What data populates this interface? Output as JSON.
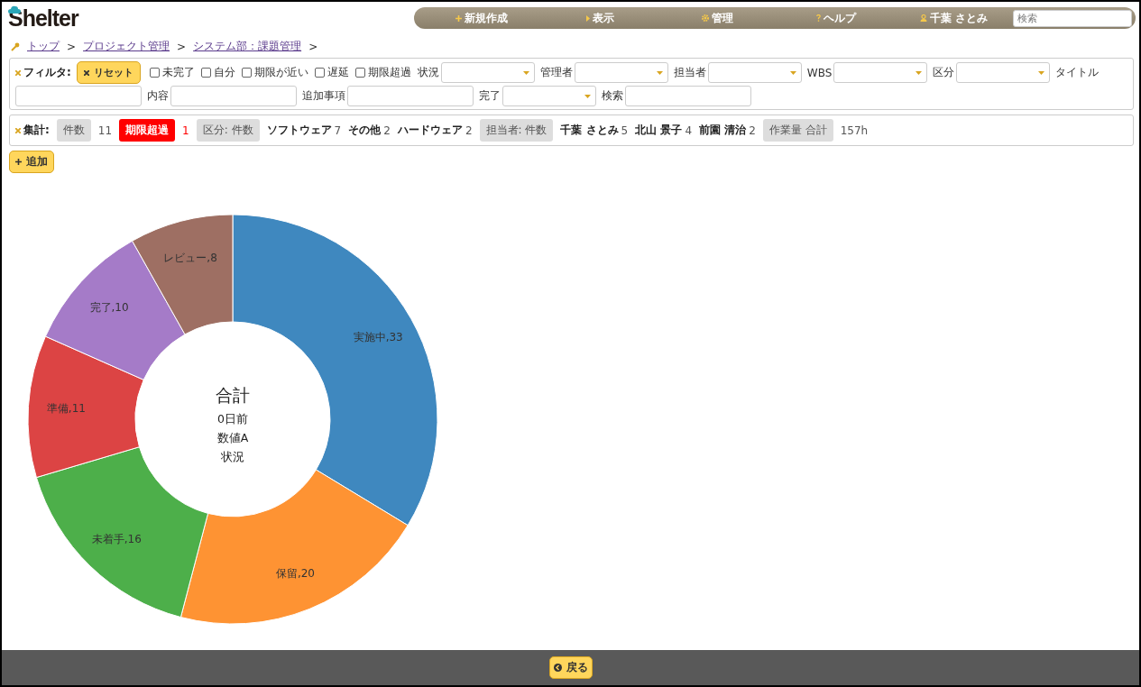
{
  "header": {
    "logo": "Shelter",
    "nav": [
      {
        "kind": "new",
        "label": "新規作成"
      },
      {
        "kind": "view",
        "label": "表示"
      },
      {
        "kind": "admin",
        "label": "管理"
      },
      {
        "kind": "help",
        "label": "ヘルプ"
      },
      {
        "kind": "user",
        "label": "千葉 さとみ"
      }
    ],
    "search": {
      "placeholder": "検索"
    }
  },
  "breadcrumb": [
    "トップ",
    "プロジェクト管理",
    "システム部：課題管理"
  ],
  "breadcrumb_separator": ">",
  "filter": {
    "label": "フィルタ:",
    "reset": "リセット",
    "checkboxes": [
      {
        "label": "未完了",
        "checked": false
      },
      {
        "label": "自分",
        "checked": false
      },
      {
        "label": "期限が近い",
        "checked": false
      },
      {
        "label": "遅延",
        "checked": false
      },
      {
        "label": "期限超過",
        "checked": false
      }
    ],
    "fields": [
      {
        "kind": "select",
        "label": "状況"
      },
      {
        "kind": "select",
        "label": "管理者"
      },
      {
        "kind": "select",
        "label": "担当者"
      },
      {
        "kind": "select",
        "label": "WBS"
      },
      {
        "kind": "select",
        "label": "区分"
      },
      {
        "kind": "text",
        "label": "タイトル"
      },
      {
        "kind": "text",
        "label": "内容"
      },
      {
        "kind": "text",
        "label": "追加事項"
      },
      {
        "kind": "select",
        "label": "完了"
      },
      {
        "kind": "text",
        "label": "検索"
      }
    ]
  },
  "summary": {
    "label": "集計:",
    "items": [
      {
        "kind": "chip",
        "text": "件数"
      },
      {
        "kind": "value",
        "text": "11"
      },
      {
        "kind": "alert",
        "text": "期限超過"
      },
      {
        "kind": "alert-value",
        "text": "1"
      },
      {
        "kind": "chip",
        "text": "区分: 件数"
      },
      {
        "kind": "name",
        "text": "ソフトウェア"
      },
      {
        "kind": "value",
        "text": "7"
      },
      {
        "kind": "name",
        "text": "その他"
      },
      {
        "kind": "value",
        "text": "2"
      },
      {
        "kind": "name",
        "text": "ハードウェア"
      },
      {
        "kind": "value",
        "text": "2"
      },
      {
        "kind": "chip",
        "text": "担当者: 件数"
      },
      {
        "kind": "name",
        "text": "千葉 さとみ"
      },
      {
        "kind": "value",
        "text": "5"
      },
      {
        "kind": "name",
        "text": "北山 景子"
      },
      {
        "kind": "value",
        "text": "4"
      },
      {
        "kind": "name",
        "text": "前園 清治"
      },
      {
        "kind": "value",
        "text": "2"
      },
      {
        "kind": "chip",
        "text": "作業量 合計"
      },
      {
        "kind": "value",
        "text": "157h"
      }
    ]
  },
  "add_button": "追加",
  "chart": {
    "center_lines": [
      "合計",
      "0日前",
      "数値A",
      "状況"
    ],
    "chart_data": {
      "type": "donut",
      "values": [
        33,
        20,
        16,
        11,
        10,
        8
      ],
      "colors": [
        "#3f88bf",
        "#fe9333",
        "#4daf4a",
        "#dc4444",
        "#a57bc8",
        "#9e6f63"
      ],
      "value_labels": [
        "実施中,33",
        "保留,20",
        "未着手,16",
        "準備,11",
        "完了,10",
        "レビュー,8"
      ]
    }
  },
  "footer": {
    "back_button": "戻る"
  }
}
